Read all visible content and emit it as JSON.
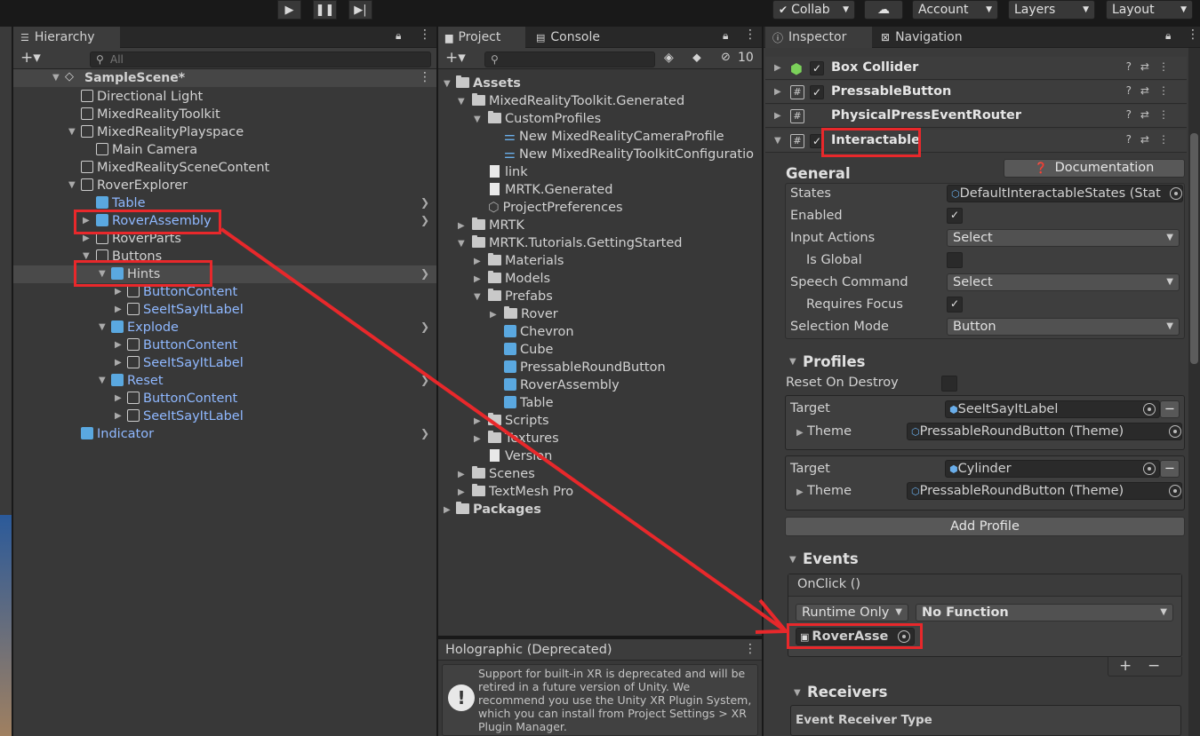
{
  "toolbar": {
    "collab": "Collab",
    "account": "Account",
    "layers": "Layers",
    "layout": "Layout"
  },
  "hierarchy": {
    "tab": "Hierarchy",
    "search_placeholder": "All",
    "scene": "SampleScene*",
    "items": [
      {
        "label": "Directional Light"
      },
      {
        "label": "MixedRealityToolkit"
      },
      {
        "label": "MixedRealityPlayspace"
      },
      {
        "label": "Main Camera"
      },
      {
        "label": "MixedRealitySceneContent"
      },
      {
        "label": "RoverExplorer"
      },
      {
        "label": "Table"
      },
      {
        "label": "RoverAssembly"
      },
      {
        "label": "RoverParts"
      },
      {
        "label": "Buttons"
      },
      {
        "label": "Hints"
      },
      {
        "label": "ButtonContent"
      },
      {
        "label": "SeeItSayItLabel"
      },
      {
        "label": "Explode"
      },
      {
        "label": "ButtonContent"
      },
      {
        "label": "SeeItSayItLabel"
      },
      {
        "label": "Reset"
      },
      {
        "label": "ButtonContent"
      },
      {
        "label": "SeeItSayItLabel"
      },
      {
        "label": "Indicator"
      }
    ]
  },
  "project": {
    "tab_project": "Project",
    "tab_console": "Console",
    "hidden_count": "10",
    "items": [
      {
        "label": "Assets"
      },
      {
        "label": "MixedRealityToolkit.Generated"
      },
      {
        "label": "CustomProfiles"
      },
      {
        "label": "New MixedRealityCameraProfile"
      },
      {
        "label": "New MixedRealityToolkitConfiguratio"
      },
      {
        "label": "link"
      },
      {
        "label": "MRTK.Generated"
      },
      {
        "label": "ProjectPreferences"
      },
      {
        "label": "MRTK"
      },
      {
        "label": "MRTK.Tutorials.GettingStarted"
      },
      {
        "label": "Materials"
      },
      {
        "label": "Models"
      },
      {
        "label": "Prefabs"
      },
      {
        "label": "Rover"
      },
      {
        "label": "Chevron"
      },
      {
        "label": "Cube"
      },
      {
        "label": "PressableRoundButton"
      },
      {
        "label": "RoverAssembly"
      },
      {
        "label": "Table"
      },
      {
        "label": "Scripts"
      },
      {
        "label": "Textures"
      },
      {
        "label": "Version"
      },
      {
        "label": "Scenes"
      },
      {
        "label": "TextMesh Pro"
      },
      {
        "label": "Packages"
      }
    ]
  },
  "holographic": {
    "title": "Holographic (Deprecated)",
    "message": "Support for built-in XR is deprecated and will be retired in a future version of Unity. We recommend you use the Unity XR Plugin System, which you can install from Project Settings > XR Plugin Manager."
  },
  "inspector": {
    "tab_inspector": "Inspector",
    "tab_navigation": "Navigation",
    "components": [
      {
        "name": "Box Collider"
      },
      {
        "name": "PressableButton"
      },
      {
        "name": "PhysicalPressEventRouter"
      },
      {
        "name": "Interactable"
      }
    ],
    "documentation": "Documentation",
    "general": "General",
    "states_label": "States",
    "states_value": "DefaultInteractableStates (Stat",
    "enabled_label": "Enabled",
    "input_actions_label": "Input Actions",
    "input_actions_value": "Select",
    "is_global_label": "Is Global",
    "speech_command_label": "Speech Command",
    "speech_command_value": "Select",
    "requires_focus_label": "Requires Focus",
    "selection_mode_label": "Selection Mode",
    "selection_mode_value": "Button",
    "profiles": "Profiles",
    "reset_on_destroy_label": "Reset On Destroy",
    "profile1": {
      "target_label": "Target",
      "target_value": "SeeItSayItLabel",
      "theme_label": "Theme",
      "theme_value": "PressableRoundButton (Theme)"
    },
    "profile2": {
      "target_label": "Target",
      "target_value": "Cylinder",
      "theme_label": "Theme",
      "theme_value": "PressableRoundButton (Theme)"
    },
    "add_profile": "Add Profile",
    "events": "Events",
    "onclick": "OnClick ()",
    "runtime_only": "Runtime Only",
    "no_function": "No Function",
    "object_field": "RoverAsse",
    "plus": "+",
    "minus": "−",
    "receivers": "Receivers",
    "event_receiver_type": "Event Receiver Type"
  },
  "colors": {
    "annotation_red": "#e8282b",
    "prefab_blue": "#8fb8ff"
  }
}
